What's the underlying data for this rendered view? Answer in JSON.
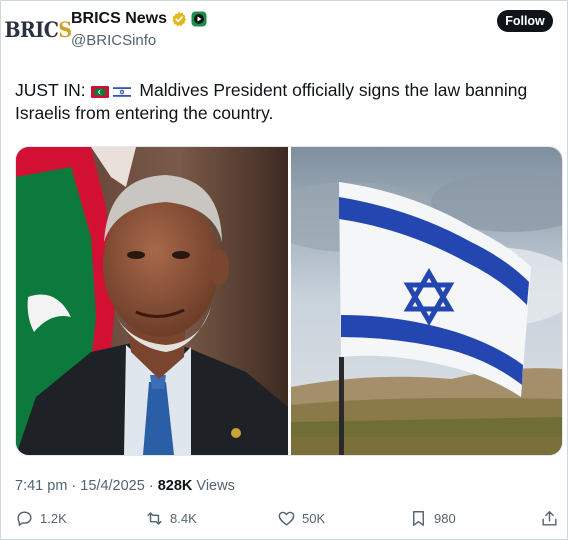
{
  "account": {
    "avatar_text_a": "BRIC",
    "avatar_text_b": "S",
    "display_name": "BRICS News",
    "handle": "@BRICSinfo",
    "follow_label": "Follow"
  },
  "tweet": {
    "prefix": "JUST IN:",
    "flags": [
      "maldives-flag-icon",
      "israel-flag-icon"
    ],
    "body": "Maldives President officially signs the law banning Israelis from entering the country."
  },
  "meta": {
    "time": "7:41 pm",
    "sep1": " · ",
    "date": "15/4/2025",
    "sep2": " · ",
    "views_count": "828K",
    "views_label": " Views"
  },
  "actions": {
    "replies": "1.2K",
    "reposts": "8.4K",
    "likes": "50K",
    "bookmarks": "980"
  },
  "colors": {
    "brand_dark": "#0f1419",
    "muted": "#536471",
    "israel_blue": "#1f3fa8",
    "maldives_red": "#d21034",
    "maldives_green": "#007e3a",
    "verified_gold": "#e2b719"
  }
}
